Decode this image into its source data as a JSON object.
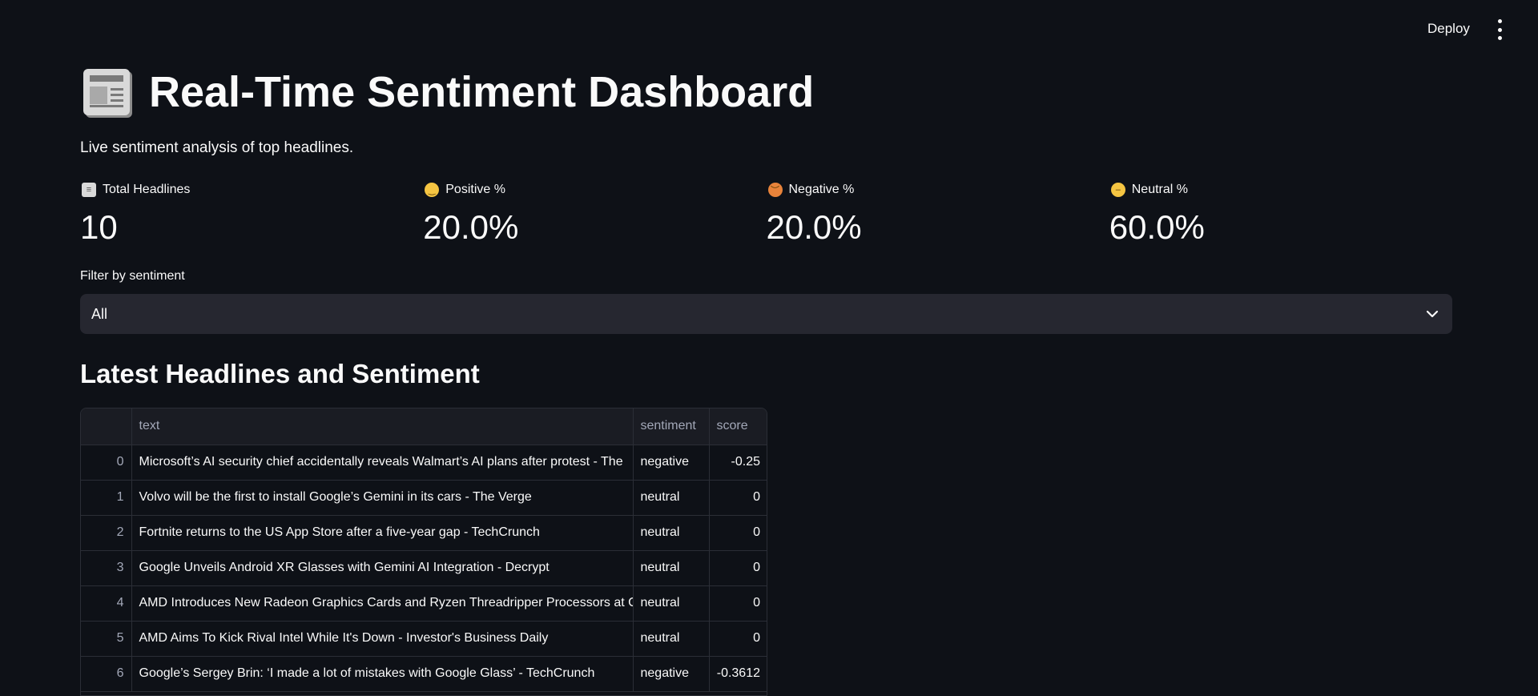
{
  "header": {
    "deploy_label": "Deploy"
  },
  "page": {
    "title": "Real-Time Sentiment Dashboard",
    "subtitle": "Live sentiment analysis of top headlines."
  },
  "metrics": [
    {
      "icon": "newspaper-icon",
      "label": "Total Headlines",
      "value": "10"
    },
    {
      "icon": "smiling-face-icon",
      "label": "Positive %",
      "value": "20.0%"
    },
    {
      "icon": "angry-face-icon",
      "label": "Negative %",
      "value": "20.0%"
    },
    {
      "icon": "neutral-face-icon",
      "label": "Neutral %",
      "value": "60.0%"
    }
  ],
  "filter": {
    "label": "Filter by sentiment",
    "selected": "All"
  },
  "section": {
    "title": "Latest Headlines and Sentiment"
  },
  "table": {
    "columns": [
      "",
      "text",
      "sentiment",
      "score"
    ],
    "rows": [
      {
        "index": "0",
        "text": "Microsoft’s AI security chief accidentally reveals Walmart’s AI plans after protest - The",
        "sentiment": "negative",
        "score": "-0.25"
      },
      {
        "index": "1",
        "text": "Volvo will be the first to install Google’s Gemini in its cars - The Verge",
        "sentiment": "neutral",
        "score": "0"
      },
      {
        "index": "2",
        "text": "Fortnite returns to the US App Store after a five-year gap - TechCrunch",
        "sentiment": "neutral",
        "score": "0"
      },
      {
        "index": "3",
        "text": "Google Unveils Android XR Glasses with Gemini AI Integration - Decrypt",
        "sentiment": "neutral",
        "score": "0"
      },
      {
        "index": "4",
        "text": "AMD Introduces New Radeon Graphics Cards and Ryzen Threadripper Processors at C",
        "sentiment": "neutral",
        "score": "0"
      },
      {
        "index": "5",
        "text": "AMD Aims To Kick Rival Intel While It's Down - Investor's Business Daily",
        "sentiment": "neutral",
        "score": "0"
      },
      {
        "index": "6",
        "text": "Google’s Sergey Brin: ‘I made a lot of mistakes with Google Glass’ - TechCrunch",
        "sentiment": "negative",
        "score": "-0.3612"
      }
    ]
  }
}
